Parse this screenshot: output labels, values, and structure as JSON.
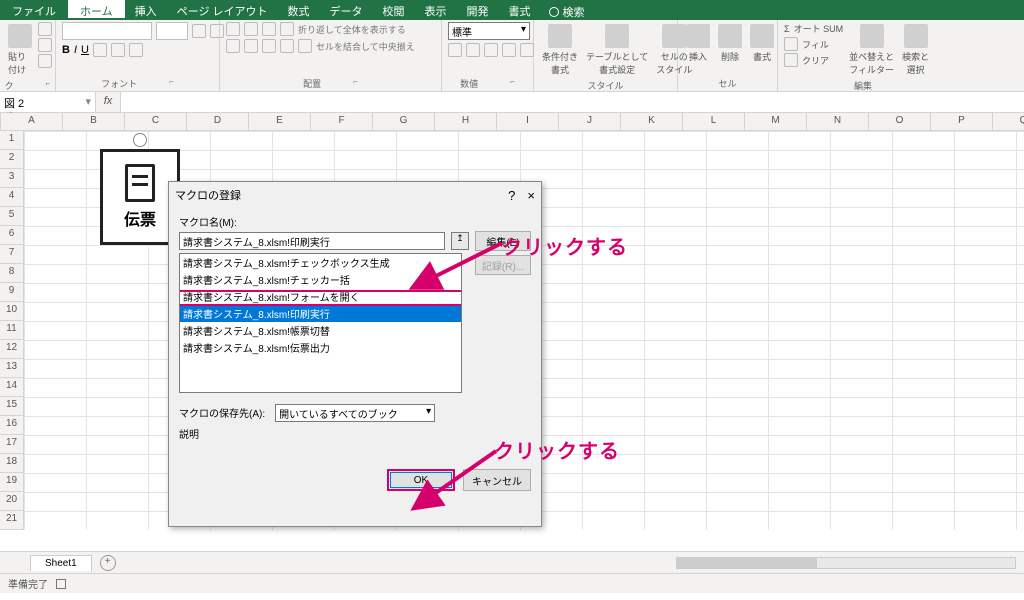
{
  "tabs": {
    "file": "ファイル",
    "home": "ホーム",
    "insert": "挿入",
    "layout": "ページ レイアウト",
    "formulas": "数式",
    "data": "データ",
    "review": "校閲",
    "view": "表示",
    "dev": "開発",
    "format": "書式",
    "tellme": "検索"
  },
  "ribbon": {
    "clipboard": {
      "paste": "貼り付け",
      "label": "クリップボード"
    },
    "font": {
      "label": "フォント",
      "sizeA": "A",
      "sizeAdown": "A"
    },
    "align": {
      "wrap": "折り返して全体を表示する",
      "merge": "セルを結合して中央揃え",
      "label": "配置"
    },
    "number": {
      "format": "標準",
      "label": "数値"
    },
    "styles": {
      "cond": "条件付き\n書式",
      "table": "テーブルとして\n書式設定",
      "cell": "セルの\nスタイル",
      "label": "スタイル"
    },
    "cells": {
      "insert": "挿入",
      "delete": "削除",
      "format": "書式",
      "label": "セル"
    },
    "editing": {
      "sum": "オート SUM",
      "fill": "フィル",
      "clear": "クリア",
      "sort": "並べ替えと\nフィルター",
      "find": "検索と\n選択",
      "label": "編集"
    }
  },
  "namebox": "図 2",
  "columns": [
    "A",
    "B",
    "C",
    "D",
    "E",
    "F",
    "G",
    "H",
    "I",
    "J",
    "K",
    "L",
    "M",
    "N",
    "O",
    "P",
    "Q"
  ],
  "rows": [
    "1",
    "2",
    "3",
    "4",
    "5",
    "6",
    "7",
    "8",
    "9",
    "10",
    "11",
    "12",
    "13",
    "14",
    "15",
    "16",
    "17",
    "18",
    "19",
    "20",
    "21"
  ],
  "shape": {
    "text": "伝票"
  },
  "dialog": {
    "title": "マクロの登録",
    "help": "?",
    "close": "×",
    "nameLabel": "マクロ名(M):",
    "nameValue": "請求書システム_8.xlsm!印刷実行",
    "edit": "編集(E)",
    "record": "記録(R)...",
    "items": [
      "請求書システム_8.xlsm!チェックボックス生成",
      "請求書システム_8.xlsm!チェッカー括",
      "請求書システム_8.xlsm!フォームを開く",
      "請求書システム_8.xlsm!印刷実行",
      "請求書システム_8.xlsm!帳票切替",
      "請求書システム_8.xlsm!伝票出力"
    ],
    "selectedIndex": 3,
    "storeLabel": "マクロの保存先(A):",
    "storeValue": "開いているすべてのブック",
    "descLabel": "説明",
    "ok": "OK",
    "cancel": "キャンセル"
  },
  "callouts": {
    "c1": "クリックする",
    "c2": "クリックする"
  },
  "sheetTab": "Sheet1",
  "status": "準備完了",
  "addSheet": "+"
}
